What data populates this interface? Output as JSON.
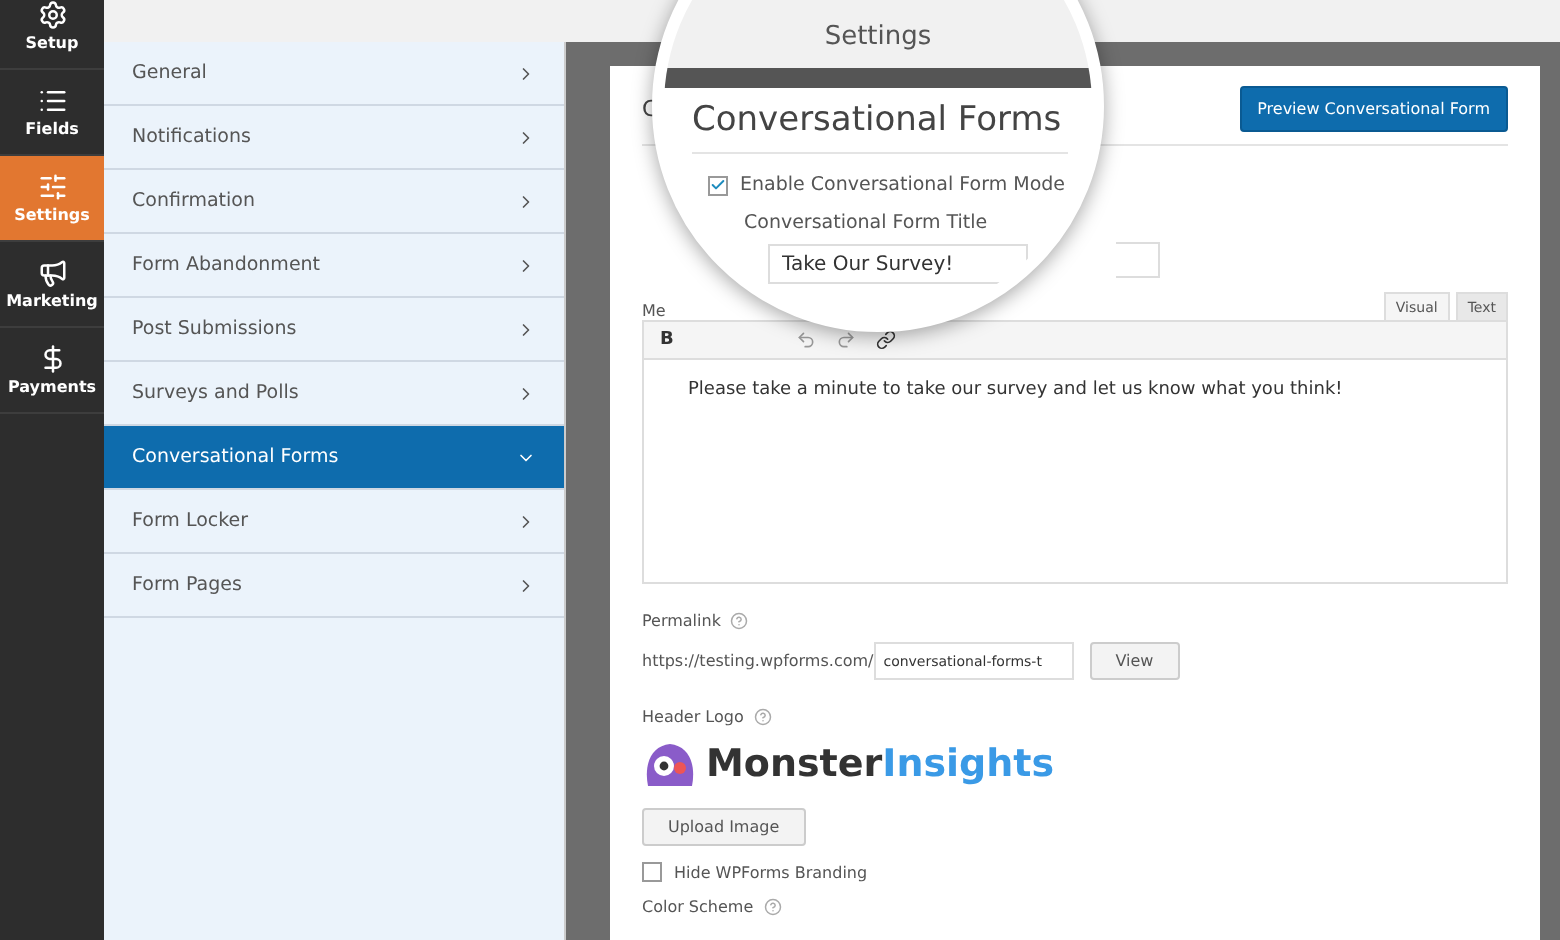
{
  "left_nav": [
    {
      "label": "Setup",
      "kind": "gear",
      "selected": false
    },
    {
      "label": "Fields",
      "kind": "fields",
      "selected": false
    },
    {
      "label": "Settings",
      "kind": "sliders",
      "selected": true
    },
    {
      "label": "Marketing",
      "kind": "megaphone",
      "selected": false
    },
    {
      "label": "Payments",
      "kind": "dollar",
      "selected": false
    }
  ],
  "settings_menu": [
    {
      "label": "General",
      "selected": false
    },
    {
      "label": "Notifications",
      "selected": false
    },
    {
      "label": "Confirmation",
      "selected": false
    },
    {
      "label": "Form Abandonment",
      "selected": false
    },
    {
      "label": "Post Submissions",
      "selected": false
    },
    {
      "label": "Surveys and Polls",
      "selected": false
    },
    {
      "label": "Conversational Forms",
      "selected": true
    },
    {
      "label": "Form Locker",
      "selected": false
    },
    {
      "label": "Form Pages",
      "selected": false
    }
  ],
  "panel": {
    "section_heading": "C",
    "preview_button": "Preview Conversational Form",
    "message_label": "Me",
    "editor_tabs": [
      {
        "label": "Visual",
        "selected": true
      },
      {
        "label": "Text",
        "selected": false
      }
    ],
    "bold_button": "B",
    "editor_text": "Please take a minute to take our survey and let us know what you think!",
    "permalink_label": "Permalink",
    "permalink_prefix": "https://testing.wpforms.com/",
    "permalink_slug": "conversational-forms-t",
    "view_button": "View",
    "header_logo_label": "Header Logo",
    "logo_text_dark": "Monster",
    "logo_text_light": "Insights",
    "upload_button": "Upload Image",
    "hide_branding": {
      "label": "Hide WPForms Branding",
      "checked": false
    },
    "color_scheme_label": "Color Scheme"
  },
  "magnifier": {
    "title": "Settings",
    "heading": "Conversational Forms",
    "enable": {
      "label": "Enable Conversational Form Mode",
      "checked": true
    },
    "field_label": "Conversational Form Title",
    "field_value": "Take Our Survey!"
  }
}
